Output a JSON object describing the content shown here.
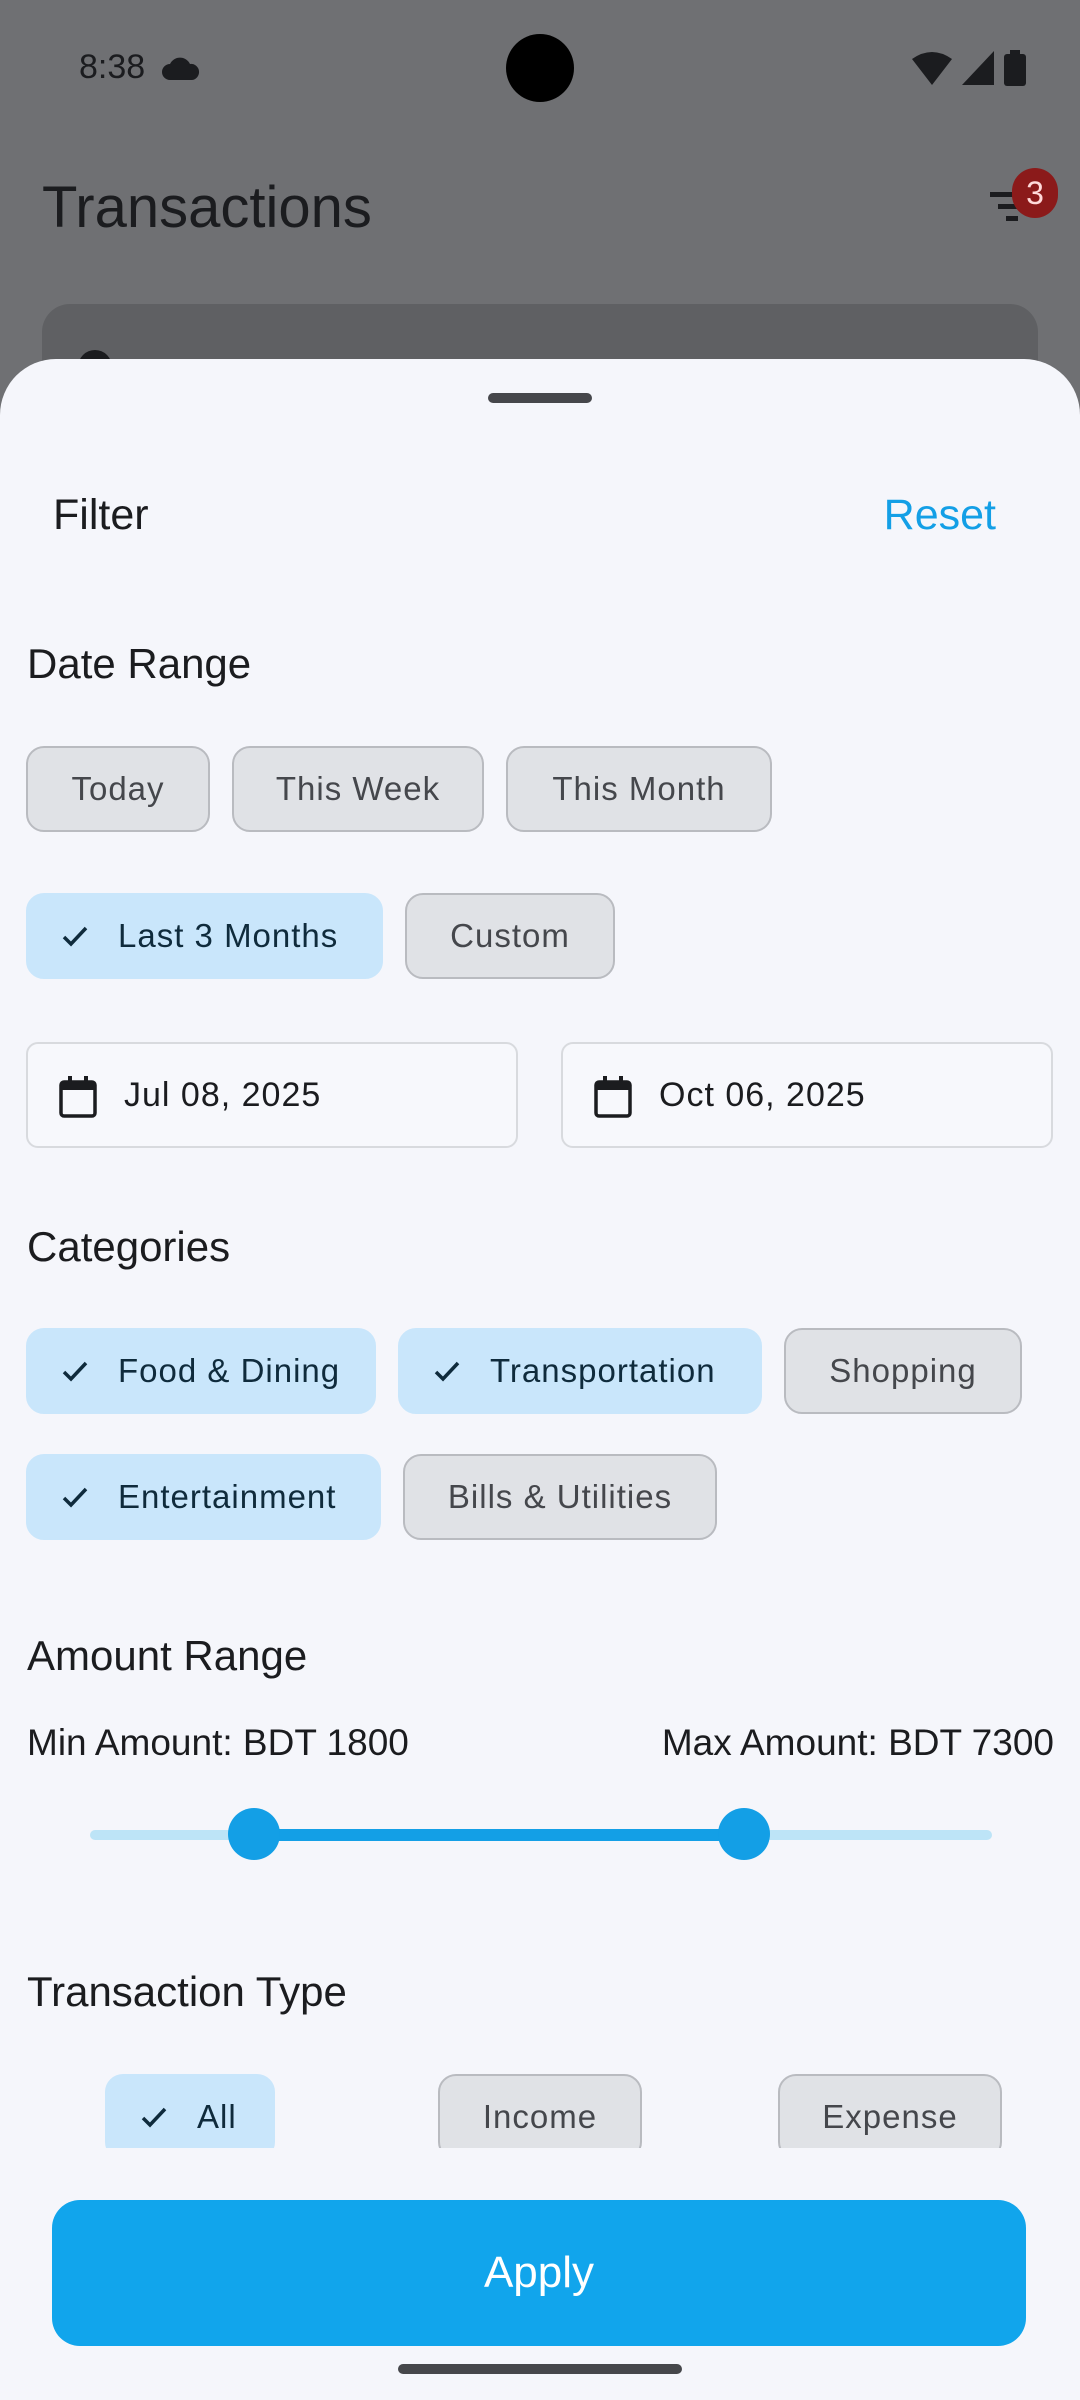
{
  "status_bar": {
    "time": "8:38"
  },
  "background": {
    "title": "Transactions",
    "filter_badge_count": "3"
  },
  "sheet": {
    "title": "Filter",
    "reset_label": "Reset",
    "date_range": {
      "title": "Date Range",
      "options": [
        {
          "label": "Today",
          "selected": false
        },
        {
          "label": "This Week",
          "selected": false
        },
        {
          "label": "This Month",
          "selected": false
        },
        {
          "label": "Last 3 Months",
          "selected": true
        },
        {
          "label": "Custom",
          "selected": false
        }
      ],
      "start_date": "Jul 08, 2025",
      "end_date": "Oct 06, 2025"
    },
    "categories": {
      "title": "Categories",
      "options": [
        {
          "label": "Food & Dining",
          "selected": true
        },
        {
          "label": "Transportation",
          "selected": true
        },
        {
          "label": "Shopping",
          "selected": false
        },
        {
          "label": "Entertainment",
          "selected": true
        },
        {
          "label": "Bills & Utilities",
          "selected": false
        }
      ]
    },
    "amount_range": {
      "title": "Amount Range",
      "min_label": "Min Amount: BDT 1800",
      "max_label": "Max Amount: BDT 7300",
      "min_value": 1800,
      "max_value": 7300
    },
    "transaction_type": {
      "title": "Transaction Type",
      "options": [
        {
          "label": "All",
          "selected": true
        },
        {
          "label": "Income",
          "selected": false
        },
        {
          "label": "Expense",
          "selected": false
        }
      ]
    },
    "apply_label": "Apply"
  },
  "colors": {
    "accent": "#139fe6",
    "chip_selected": "#c9e6fb",
    "chip_unselected": "#e0e2e6",
    "badge": "#8b1a1a"
  }
}
